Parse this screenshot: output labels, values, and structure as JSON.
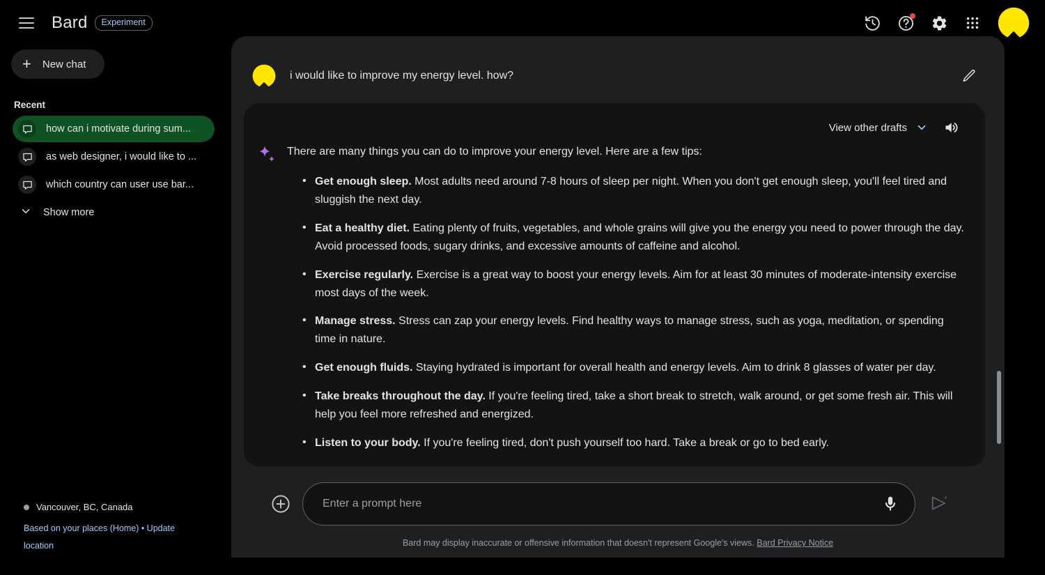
{
  "header": {
    "menu_icon": "hamburger-icon",
    "brand": "Bard",
    "badge": "Experiment",
    "icons": [
      {
        "name": "history-icon",
        "label": "Activity"
      },
      {
        "name": "help-icon",
        "label": "Help",
        "badge": true
      },
      {
        "name": "gear-icon",
        "label": "Settings"
      },
      {
        "name": "apps-grid-icon",
        "label": "Google apps"
      }
    ],
    "avatar": {
      "name": "user-avatar",
      "color": "#FFE500"
    }
  },
  "sidebar": {
    "new_chat_label": "New chat",
    "recent_label": "Recent",
    "chats": [
      {
        "title": "how can i motivate during sum...",
        "active": true
      },
      {
        "title": "as web designer, i would like to ...",
        "active": false
      },
      {
        "title": "which country can user use bar...",
        "active": false
      }
    ],
    "show_more_label": "Show more",
    "location": {
      "name": "Vancouver, BC, Canada",
      "sub": "Based on your places (Home) • Update location"
    }
  },
  "conversation": {
    "user_prompt": "i would like to improve my energy level. how?",
    "edit_icon": "edit-pencil-icon",
    "drafts_label": "View other drafts",
    "speaker_icon": "speaker-icon",
    "intro": "There are many things you can do to improve your energy level. Here are a few tips:",
    "tips": [
      {
        "title": "Get enough sleep.",
        "body": " Most adults need around 7-8 hours of sleep per night. When you don't get enough sleep, you'll feel tired and sluggish the next day."
      },
      {
        "title": "Eat a healthy diet.",
        "body": " Eating plenty of fruits, vegetables, and whole grains will give you the energy you need to power through the day. Avoid processed foods, sugary drinks, and excessive amounts of caffeine and alcohol."
      },
      {
        "title": "Exercise regularly.",
        "body": " Exercise is a great way to boost your energy levels. Aim for at least 30 minutes of moderate-intensity exercise most days of the week."
      },
      {
        "title": "Manage stress.",
        "body": " Stress can zap your energy levels. Find healthy ways to manage stress, such as yoga, meditation, or spending time in nature."
      },
      {
        "title": "Get enough fluids.",
        "body": " Staying hydrated is important for overall health and energy levels. Aim to drink 8 glasses of water per day."
      },
      {
        "title": "Take breaks throughout the day.",
        "body": " If you're feeling tired, take a short break to stretch, walk around, or get some fresh air. This will help you feel more refreshed and energized."
      },
      {
        "title": "Listen to your body.",
        "body": " If you're feeling tired, don't push yourself too hard. Take a break or go to bed early."
      }
    ]
  },
  "composer": {
    "add_icon": "plus-circle-icon",
    "placeholder": "Enter a prompt here",
    "value": "",
    "mic_icon": "microphone-icon",
    "send_icon": "send-icon",
    "disclaimer": "Bard may display inaccurate or offensive information that doesn't represent Google's views.",
    "privacy_link": "Bard Privacy Notice"
  },
  "colors": {
    "page_bg": "#000000",
    "panel_bg": "#1e1f20",
    "card_bg": "#131314",
    "accent_blue": "#a8c7fa",
    "active_chat": "#0f5223",
    "avatar_yellow": "#FFE500"
  }
}
